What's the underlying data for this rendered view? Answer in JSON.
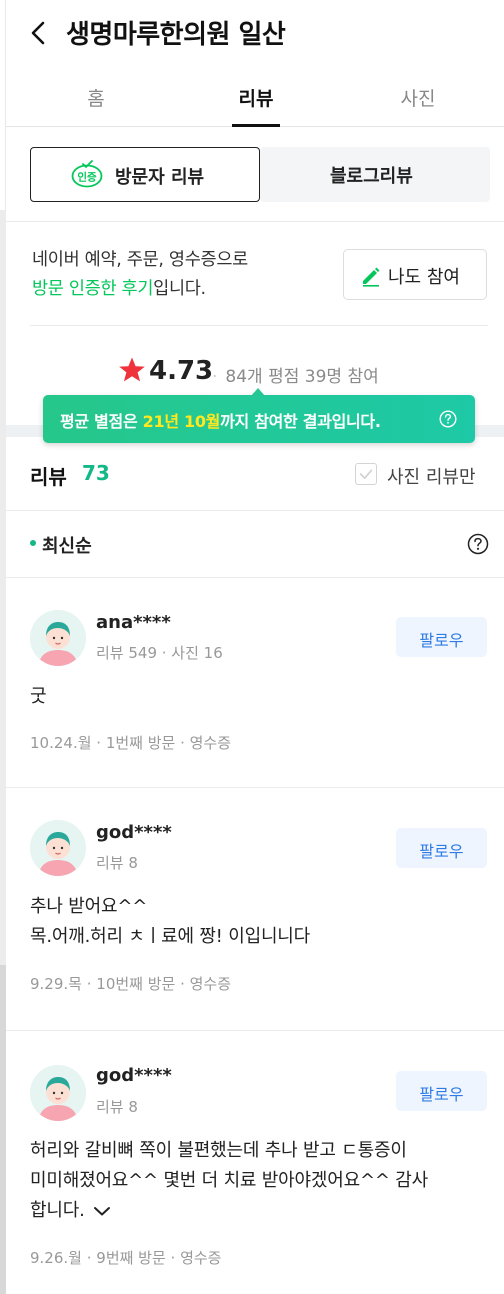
{
  "header": {
    "title": "생명마루한의원 일산",
    "back_icon": "chevron-left-icon"
  },
  "tabs": [
    {
      "label": "홈"
    },
    {
      "label": "리뷰"
    },
    {
      "label": "사진"
    }
  ],
  "review_type": {
    "visitor_badge": "인증",
    "visitor_label": "방문자 리뷰",
    "blog_label": "블로그리뷰"
  },
  "certification": {
    "line1": "네이버 예약, 주문, 영수증으로",
    "line2_green": "방문 인증한 후기",
    "line2_rest": "입니다.",
    "join_label": "나도 참여"
  },
  "rating": {
    "score": "4.73",
    "separator": "·",
    "meta": "84개 평점 39명 참여",
    "star_color": "#f0323c"
  },
  "tooltip": {
    "part1": "평균 별점은 ",
    "hl1": "21년 10월",
    "part2": "까지 참여한 결과입니다.",
    "help_icon": "question-circle-icon"
  },
  "review_count": {
    "label": "리뷰",
    "count": "73",
    "photo_only_label": "사진 리뷰만"
  },
  "sort": {
    "label": "최신순"
  },
  "reviews": [
    {
      "name": "ana****",
      "stats": "리뷰 549 · 사진 16",
      "follow": "팔로우",
      "lines": [
        "굿"
      ],
      "meta": "10.24.월 · 1번째 방문 · 영수증"
    },
    {
      "name": "god****",
      "stats": "리뷰 8",
      "follow": "팔로우",
      "lines": [
        "추나 받어요^^",
        "목.어깨.허리 ㅊㅣ료에 짱! 이입니니다"
      ],
      "meta": "9.29.목 · 10번째 방문 · 영수증"
    },
    {
      "name": "god****",
      "stats": "리뷰 8",
      "follow": "팔로우",
      "lines": [
        "허리와 갈비뼈 쪽이 불편했는데 추나 받고 ㄷ통증이",
        "미미해졌어요^^ 몇번 더 치료 받아야겠어요^^ 감사",
        "합니다."
      ],
      "meta": "9.26.월 · 9번째 방문 · 영수증"
    }
  ],
  "colors": {
    "accent_green": "#03c75a",
    "count_teal": "#12b886",
    "follow_blue": "#2f7be5"
  }
}
